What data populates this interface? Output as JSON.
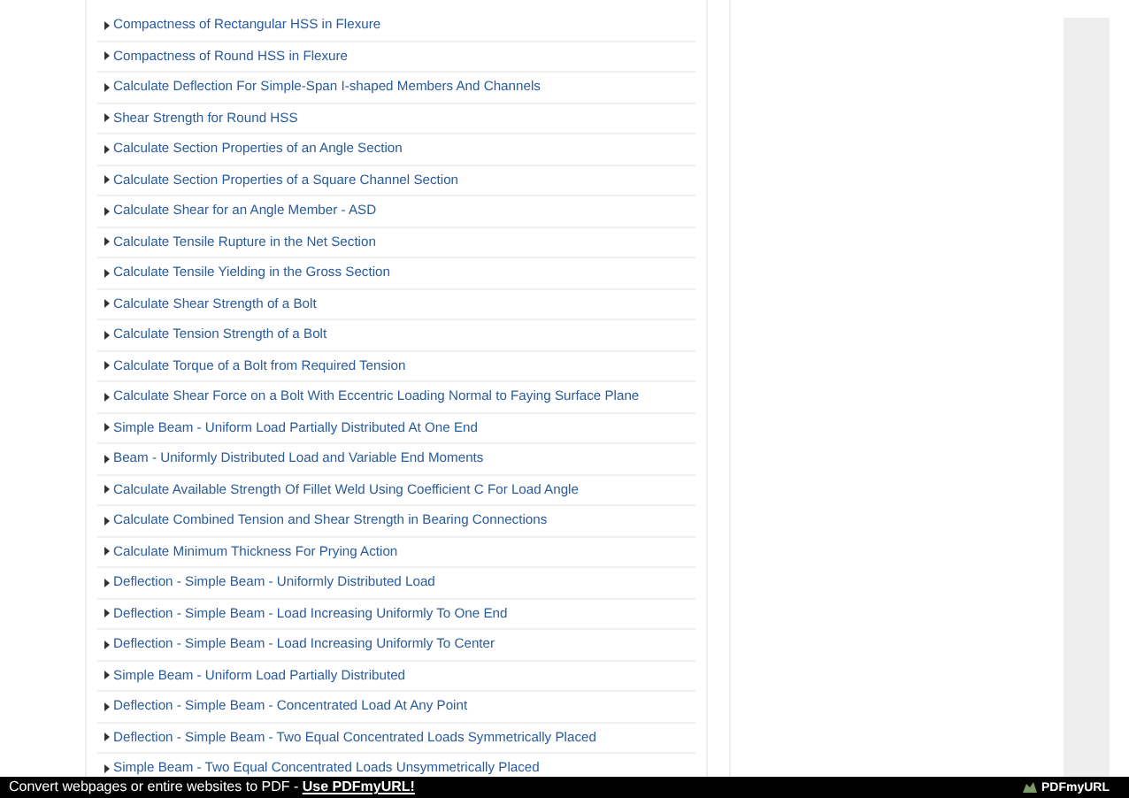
{
  "links": [
    "Compactness of Rectangular HSS in Flexure",
    "Compactness of Round HSS in Flexure",
    "Calculate Deflection For Simple-Span I-shaped Members And Channels",
    "Shear Strength for Round HSS",
    "Calculate Section Properties of an Angle Section",
    "Calculate Section Properties of a Square Channel Section",
    "Calculate Shear for an Angle Member - ASD",
    "Calculate Tensile Rupture in the Net Section",
    "Calculate Tensile Yielding in the Gross Section",
    "Calculate Shear Strength of a Bolt",
    "Calculate Tension Strength of a Bolt",
    "Calculate Torque of a Bolt from Required Tension",
    "Calculate Shear Force on a Bolt With Eccentric Loading Normal to Faying Surface Plane",
    "Simple Beam - Uniform Load Partially Distributed At One End",
    "Beam - Uniformly Distributed Load and Variable End Moments",
    "Calculate Available Strength Of Fillet Weld Using Coefficient C For Load Angle",
    "Calculate Combined Tension and Shear Strength in Bearing Connections",
    "Calculate Minimum Thickness For Prying Action",
    "Deflection - Simple Beam - Uniformly Distributed Load",
    "Deflection - Simple Beam - Load Increasing Uniformly To One End",
    "Deflection - Simple Beam - Load Increasing Uniformly To Center",
    "Simple Beam - Uniform Load Partially Distributed",
    "Deflection - Simple Beam - Concentrated Load At Any Point",
    "Deflection - Simple Beam - Two Equal Concentrated Loads Symmetrically Placed",
    "Simple Beam - Two Equal Concentrated Loads Unsymmetrically Placed"
  ],
  "footer": {
    "text": "Convert webpages or entire websites to PDF - ",
    "link": "Use PDFmyURL!",
    "logo": "PDFmyURL"
  }
}
